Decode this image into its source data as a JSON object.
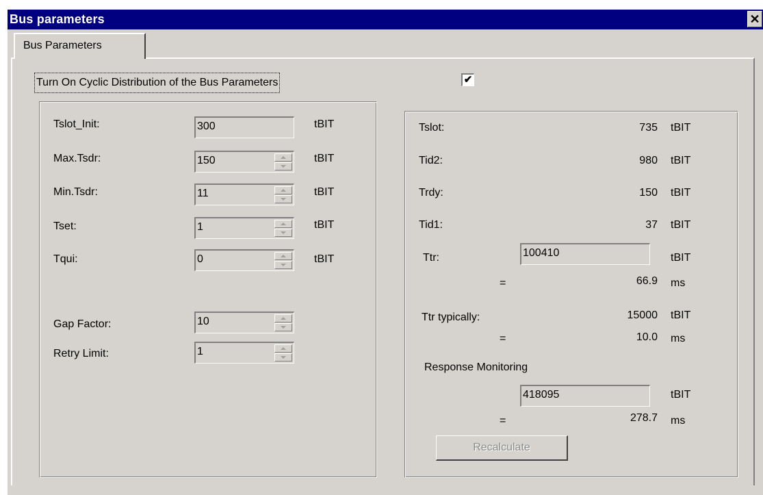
{
  "window": {
    "title": "Bus parameters",
    "close_glyph": "✕"
  },
  "tab": {
    "label": "Bus Parameters"
  },
  "cyclic": {
    "label": "Turn On Cyclic Distribution of the Bus Parameters",
    "checked": true,
    "check_glyph": "✔"
  },
  "left": {
    "tslot_init": {
      "label": "Tslot_Init:",
      "value": "300",
      "unit": "tBIT"
    },
    "max_tsdr": {
      "label": "Max.Tsdr:",
      "value": "150",
      "unit": "tBIT"
    },
    "min_tsdr": {
      "label": "Min.Tsdr:",
      "value": "11",
      "unit": "tBIT"
    },
    "tset": {
      "label": "Tset:",
      "value": "1",
      "unit": "tBIT"
    },
    "tqui": {
      "label": "Tqui:",
      "value": "0",
      "unit": "tBIT"
    },
    "gap_factor": {
      "label": "Gap Factor:",
      "value": "10"
    },
    "retry_limit": {
      "label": "Retry Limit:",
      "value": "1"
    }
  },
  "right": {
    "tslot": {
      "label": "Tslot:",
      "value": "735",
      "unit": "tBIT"
    },
    "tid2": {
      "label": "Tid2:",
      "value": "980",
      "unit": "tBIT"
    },
    "trdy": {
      "label": "Trdy:",
      "value": "150",
      "unit": "tBIT"
    },
    "tid1": {
      "label": "Tid1:",
      "value": "37",
      "unit": "tBIT"
    },
    "ttr": {
      "label": "Ttr:",
      "value": "100410",
      "unit": "tBIT",
      "eq": "=",
      "ms_value": "66.9",
      "ms_unit": "ms"
    },
    "ttr_typ": {
      "label": "Ttr typically:",
      "value": "15000",
      "unit": "tBIT",
      "eq": "=",
      "ms_value": "10.0",
      "ms_unit": "ms"
    },
    "response": {
      "label": "Response Monitoring",
      "value": "418095",
      "unit": "tBIT",
      "eq": "=",
      "ms_value": "278.7",
      "ms_unit": "ms"
    }
  },
  "buttons": {
    "recalculate": "Recalculate"
  },
  "colors": {
    "titlebar": "#000080",
    "face": "#d6d3ce"
  }
}
